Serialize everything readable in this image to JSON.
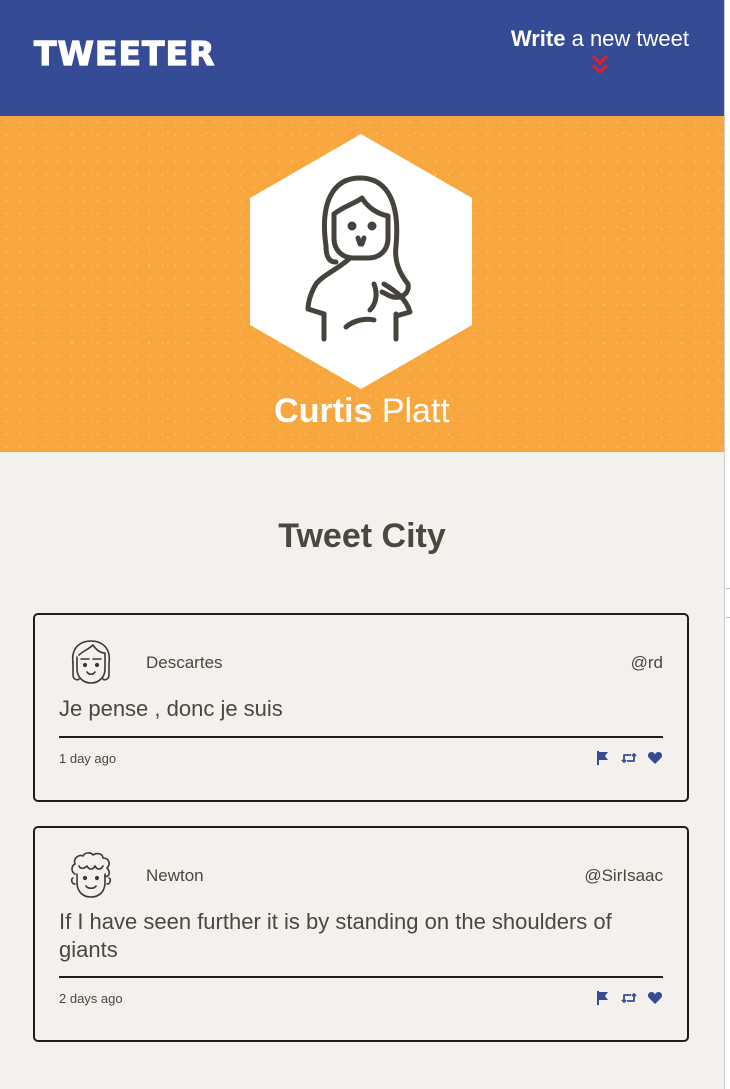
{
  "nav": {
    "logo": "TWEETER",
    "compose_bold": "Write",
    "compose_rest": " a new tweet"
  },
  "profile": {
    "first_name": "Curtis",
    "last_name": " Platt"
  },
  "main": {
    "title": "Tweet City"
  },
  "tweets": [
    {
      "author": "Descartes",
      "handle": "@rd",
      "text": "Je pense , donc je suis",
      "time": "1 day ago",
      "avatar_icon": "girl-avatar-icon"
    },
    {
      "author": "Newton",
      "handle": "@SirIsaac",
      "text": "If I have seen further it is by standing on the shoulders of giants",
      "time": "2 days ago",
      "avatar_icon": "curly-hair-avatar-icon"
    }
  ],
  "colors": {
    "nav_bg": "#364b96",
    "hero_bg": "#f7a73d",
    "page_bg": "#f4f1ec",
    "accent_red": "#e0202b",
    "action_blue": "#364b96",
    "text": "#4a4640"
  },
  "icons": [
    "double-chevron-down-icon",
    "flag-icon",
    "retweet-icon",
    "heart-icon"
  ]
}
